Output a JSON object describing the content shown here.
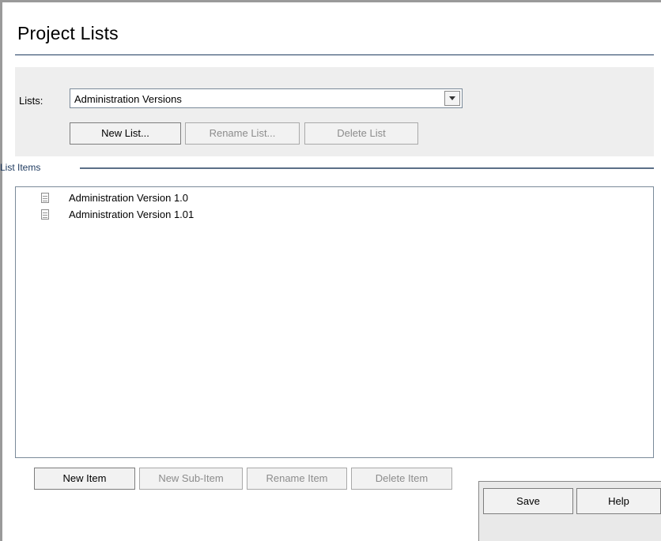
{
  "page": {
    "title": "Project Lists"
  },
  "lists": {
    "label": "Lists:",
    "selected": "Administration Versions",
    "buttons": {
      "new_list": "New List...",
      "rename_list": "Rename List...",
      "delete_list": "Delete List"
    }
  },
  "list_items": {
    "section_label": "List Items",
    "items": [
      {
        "label": "Administration Version 1.0"
      },
      {
        "label": "Administration Version 1.01"
      }
    ],
    "buttons": {
      "new_item": "New Item",
      "new_sub_item": "New Sub-Item",
      "rename_item": "Rename Item",
      "delete_item": "Delete Item"
    }
  },
  "footer": {
    "save": "Save",
    "help": "Help"
  }
}
